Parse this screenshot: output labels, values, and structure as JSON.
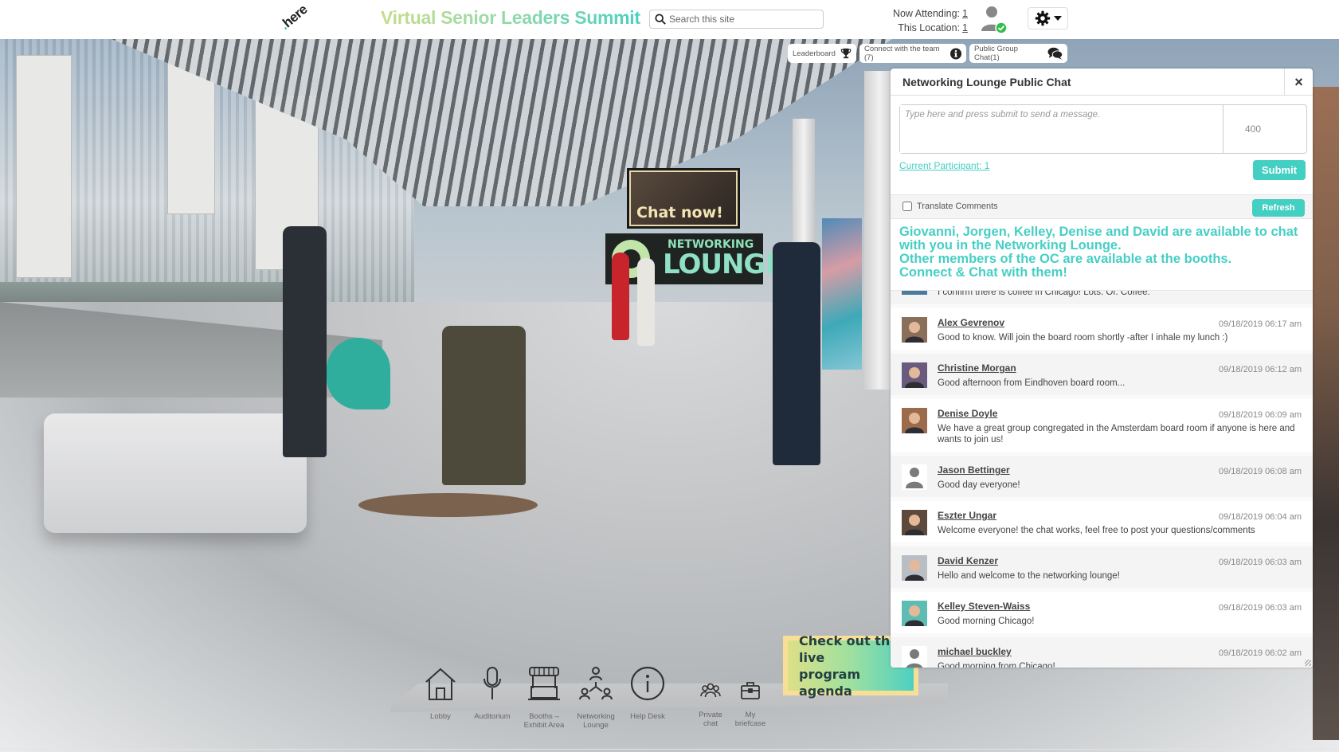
{
  "header": {
    "logo": "here",
    "title": "Virtual Senior Leaders Summit",
    "search_placeholder": "Search this site",
    "now_attending_label": "Now Attending:",
    "now_attending_value": "1",
    "this_location_label": "This Location:",
    "this_location_value": "1",
    "user_status": "online"
  },
  "toolbar": {
    "leaderboard": "Leaderboard",
    "connect_team": "Connect with the team (7)",
    "public_group_chat": "Public Group Chat(1)"
  },
  "scene": {
    "chat_sign": "Chat now!",
    "lounge_sign_top": "NETWORKING",
    "lounge_sign_bottom": "LOUNGE"
  },
  "chat": {
    "title": "Networking Lounge Public Chat",
    "close": "×",
    "placeholder": "Type here and press submit to send a message.",
    "char_count": "400",
    "participant_link": "Current Participant: 1",
    "submit_label": "Submit",
    "translate_label": "Translate Comments",
    "refresh_label": "Refresh",
    "announcement": "Giovanni, Jorgen, Kelley, Denise and David are available to chat with you in the Networking Lounge.\nOther members of the OC are available at the booths.\nConnect & Chat with them!",
    "partial_message": "I confirm there is coffee in Chicago!  Lots. Of. Coffee.",
    "messages": [
      {
        "name": "Alex Gevrenov",
        "time": "09/18/2019 06:17 am",
        "text": "Good to know. Will join the board room shortly -after I inhale my lunch :)",
        "avatar": "photo"
      },
      {
        "name": "Christine Morgan",
        "time": "09/18/2019 06:12 am",
        "text": "Good afternoon from Eindhoven board room...",
        "avatar": "photo"
      },
      {
        "name": "Denise Doyle",
        "time": "09/18/2019 06:09 am",
        "text": "We have a great group congregated in the Amsterdam board room if anyone is here and wants to join us!",
        "avatar": "photo"
      },
      {
        "name": "Jason Bettinger",
        "time": "09/18/2019 06:08 am",
        "text": "Good day everyone!",
        "avatar": "default"
      },
      {
        "name": "Eszter Ungar",
        "time": "09/18/2019 06:04 am",
        "text": "Welcome everyone! the chat works, feel free to post your questions/comments",
        "avatar": "photo"
      },
      {
        "name": "David Kenzer",
        "time": "09/18/2019 06:03 am",
        "text": "Hello and welcome to the networking lounge!",
        "avatar": "photo"
      },
      {
        "name": "Kelley Steven-Waiss",
        "time": "09/18/2019 06:03 am",
        "text": "Good morning Chicago!",
        "avatar": "photo"
      },
      {
        "name": "michael buckley",
        "time": "09/18/2019 06:02 am",
        "text": "Good morning from Chicago!",
        "avatar": "default"
      }
    ]
  },
  "nav": {
    "items": [
      {
        "label": "Lobby",
        "icon": "home-icon"
      },
      {
        "label": "Auditorium",
        "icon": "microphone-icon"
      },
      {
        "label": "Booths –\nExhibit Area",
        "icon": "booth-icon"
      },
      {
        "label": "Networking\nLounge",
        "icon": "network-icon"
      },
      {
        "label": "Help Desk",
        "icon": "info-icon"
      },
      {
        "label": "Private\nchat",
        "icon": "group-icon"
      },
      {
        "label": "My\nbriefcase",
        "icon": "briefcase-icon"
      }
    ]
  },
  "agenda": {
    "label": "Check out the live\nprogram agenda"
  },
  "colors": {
    "accent": "#43cfc2",
    "online": "#2fbf4a"
  }
}
